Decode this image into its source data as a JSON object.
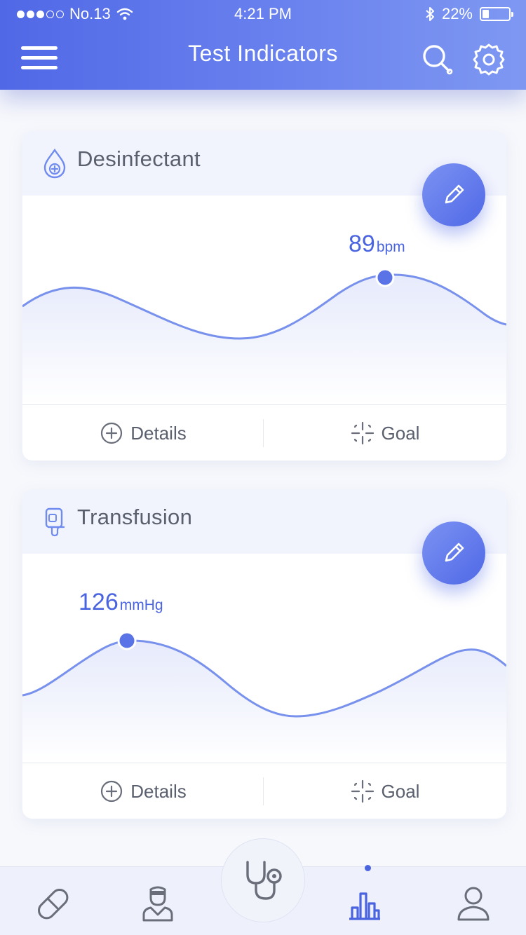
{
  "status_bar": {
    "carrier": "No.13",
    "time": "4:21 PM",
    "battery": "22%",
    "signal_dots_filled": 3,
    "signal_dots_total": 5,
    "battery_fraction": 0.22
  },
  "header": {
    "title": "Test Indicators",
    "menu_icon": "hamburger-icon",
    "search_icon": "search-icon",
    "settings_icon": "gear-icon"
  },
  "cards": [
    {
      "title": "Desinfectant",
      "icon": "drop-plus-icon",
      "reading_value": "89",
      "reading_unit": "bpm",
      "details_label": "Details",
      "goal_label": "Goal",
      "edit_icon": "pencil-icon"
    },
    {
      "title": "Transfusion",
      "icon": "iv-bag-icon",
      "reading_value": "126",
      "reading_unit": "mmHg",
      "details_label": "Details",
      "goal_label": "Goal",
      "edit_icon": "pencil-icon"
    }
  ],
  "tabbar": {
    "items": [
      "pill-icon",
      "doctor-icon",
      "stethoscope-icon",
      "bar-chart-icon",
      "user-icon"
    ],
    "active": "bar-chart-icon"
  },
  "colors": {
    "accent": "#4a64e0",
    "header_start": "#5068e6",
    "header_end": "#7e98f2",
    "text": "#5a5f6d",
    "card_head_bg": "#f2f4fd"
  }
}
